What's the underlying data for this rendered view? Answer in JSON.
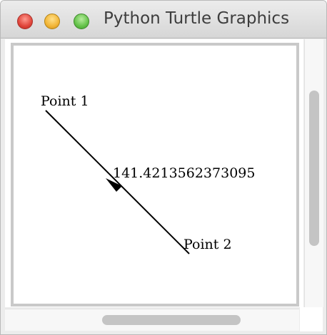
{
  "window": {
    "title": "Python Turtle Graphics"
  },
  "canvas": {
    "point1_label": "Point 1",
    "point2_label": "Point 2",
    "distance_label": "141.4213562373095",
    "line_color": "#000000",
    "turtle_icon": "turtle-arrow-icon"
  }
}
